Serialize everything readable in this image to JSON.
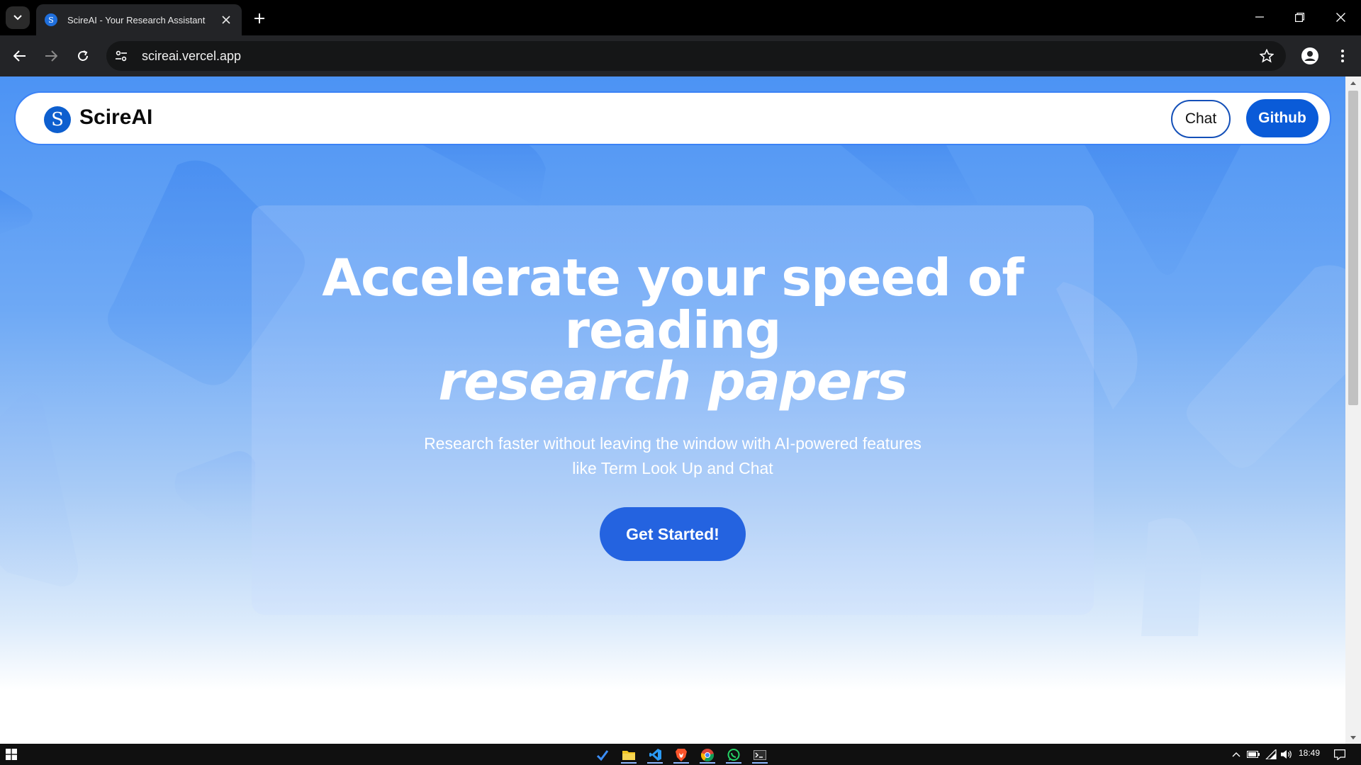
{
  "browser": {
    "tab": {
      "title": "ScireAI - Your Research Assistant",
      "favicon": "S"
    },
    "url": "scireai.vercel.app"
  },
  "site": {
    "logo": {
      "mark": "S",
      "text": "ScireAI"
    },
    "nav": {
      "chat_label": "Chat",
      "github_label": "Github"
    },
    "hero": {
      "line1": "Accelerate your speed of",
      "line2": "reading",
      "line3": "research papers",
      "subtitle_line1": "Research faster without leaving the window with AI-powered features",
      "subtitle_line2": "like Term Look Up and Chat",
      "cta_label": "Get Started!"
    }
  },
  "taskbar": {
    "apps": [
      "todo-icon",
      "file-explorer-icon",
      "vscode-icon",
      "brave-icon",
      "chrome-icon",
      "whatsapp-icon",
      "terminal-icon"
    ],
    "clock": "18:49"
  },
  "colors": {
    "brand_blue": "#0a5bd8",
    "cta_blue": "#2463e0",
    "page_gradient_top": "#4c93f4"
  }
}
